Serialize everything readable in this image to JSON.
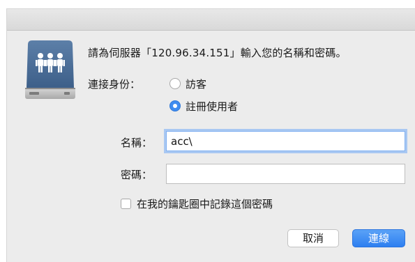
{
  "dialog": {
    "message": "請為伺服器「120.96.34.151」輸入您的名稱和密碼。",
    "connect_as_label": "連接身份：",
    "radio_guest": "訪客",
    "radio_registered": "註冊使用者",
    "name_label": "名稱：",
    "name_value": "acc\\",
    "password_label": "密碼：",
    "password_value": "",
    "remember_label": "在我的鑰匙圈中記錄這個密碼",
    "cancel_label": "取消",
    "connect_label": "連線",
    "accent_color": "#3f8cf0",
    "icon": "server-users-icon"
  }
}
